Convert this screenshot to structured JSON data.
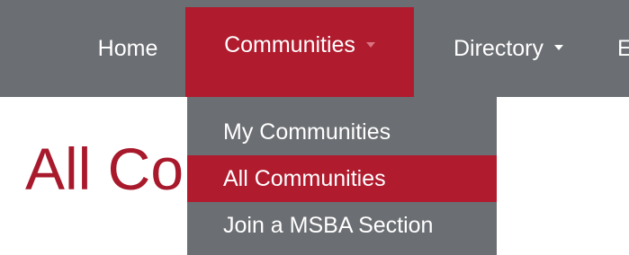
{
  "nav": {
    "items": [
      {
        "label": "Home"
      },
      {
        "label": "Communities"
      },
      {
        "label": "Directory"
      },
      {
        "label": "E"
      }
    ]
  },
  "dropdown": {
    "items": [
      {
        "label": "My Communities"
      },
      {
        "label": "All Communities"
      },
      {
        "label": "Join a MSBA Section"
      }
    ]
  },
  "page": {
    "title": "All Co"
  },
  "colors": {
    "navbar": "#6b6e72",
    "accent": "#b01b2e",
    "title": "#a8192c"
  },
  "icons": {
    "communities_caret": "chevron-down-icon",
    "directory_caret": "chevron-down-icon"
  }
}
